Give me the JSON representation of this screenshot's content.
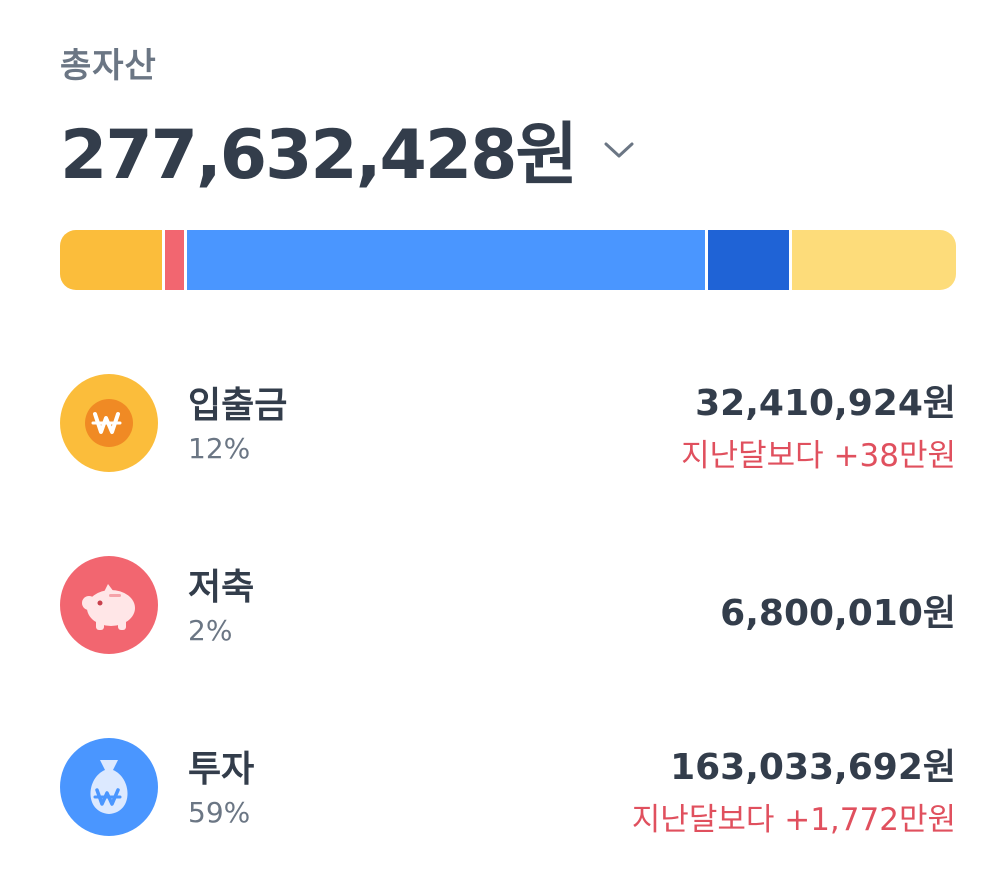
{
  "header": {
    "title": "총자산",
    "total": "277,632,428원"
  },
  "distribution_bar": {
    "segments": [
      {
        "id": "cash",
        "share": 0.115,
        "color": "#fbbd3b"
      },
      {
        "id": "savings",
        "share": 0.022,
        "color": "#f26670"
      },
      {
        "id": "investment",
        "share": 0.586,
        "color": "#4a96ff"
      },
      {
        "id": "other-investment",
        "share": 0.092,
        "color": "#1f63d6"
      },
      {
        "id": "other",
        "share": 0.185,
        "color": "#fddc7a"
      }
    ]
  },
  "accounts": [
    {
      "name": "입출금",
      "percent": "12%",
      "amount": "32,410,924원",
      "change": "지난달보다 +38만원",
      "icon": "won-coin-icon"
    },
    {
      "name": "저축",
      "percent": "2%",
      "amount": "6,800,010원",
      "change": "",
      "icon": "piggy-bank-icon"
    },
    {
      "name": "투자",
      "percent": "59%",
      "amount": "163,033,692원",
      "change": "지난달보다 +1,772만원",
      "icon": "money-bag-icon"
    }
  ],
  "colors": {
    "text_primary": "#333d4b",
    "text_secondary": "#6b7684",
    "increase": "#e0505e"
  }
}
